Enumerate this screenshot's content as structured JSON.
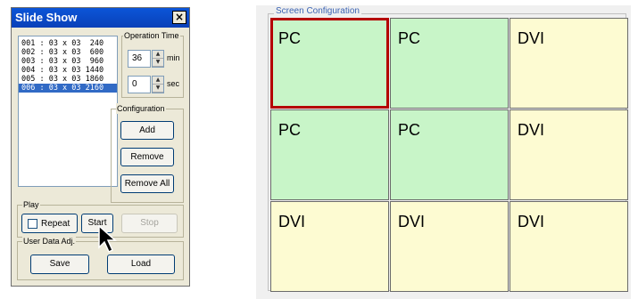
{
  "window": {
    "title": "Slide Show",
    "close_glyph": "×"
  },
  "list": {
    "items": [
      "001 : 03 x 03  240",
      "002 : 03 x 03  600",
      "003 : 03 x 03  960",
      "004 : 03 x 03 1440",
      "005 : 03 x 03 1860",
      "006 : 03 x 03 2160"
    ],
    "selected_index": 5
  },
  "operation_time": {
    "label": "Operation Time",
    "minutes": "36",
    "min_unit": "min",
    "seconds": "0",
    "sec_unit": "sec"
  },
  "configuration": {
    "label": "Configuration",
    "add": "Add",
    "remove": "Remove",
    "remove_all": "Remove All"
  },
  "play": {
    "label": "Play",
    "repeat": "Repeat",
    "repeat_checked": false,
    "start": "Start",
    "stop": "Stop"
  },
  "user_data": {
    "label": "User Data Adj.",
    "save": "Save",
    "load": "Load"
  },
  "screen_config": {
    "label": "Screen Configuration",
    "cells": [
      "PC",
      "PC",
      "DVI",
      "PC",
      "PC",
      "DVI",
      "DVI",
      "DVI",
      "DVI"
    ],
    "selected_cell": 0,
    "colors": {
      "pc": "#c8f5c8",
      "dvi": "#fdfbd2",
      "selected_border": "#b40000"
    }
  }
}
